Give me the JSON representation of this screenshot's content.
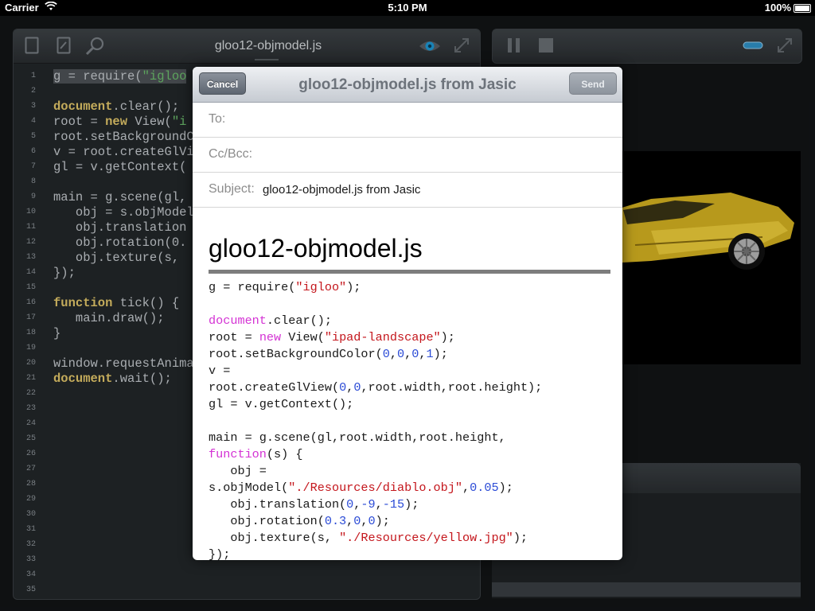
{
  "status_bar": {
    "carrier": "Carrier",
    "time": "5:10 PM",
    "battery": "100%"
  },
  "editor": {
    "title": "gloo12-objmodel.js",
    "lines": [
      {
        "n": "1",
        "html": "<span class=\"hl\">g = require(<span class=\"str\">\"igloo</span></span>"
      },
      {
        "n": "2",
        "html": ""
      },
      {
        "n": "3",
        "html": "<span class=\"kw\">document</span>.clear();"
      },
      {
        "n": "4",
        "html": "root = <span class=\"kw\">new</span> View(<span class=\"str\">\"i</span>"
      },
      {
        "n": "5",
        "html": "root.setBackgroundC"
      },
      {
        "n": "6",
        "html": "v = root.createGlVi"
      },
      {
        "n": "7",
        "html": "gl = v.getContext("
      },
      {
        "n": "8",
        "html": ""
      },
      {
        "n": "9",
        "html": "main = g.scene(gl,"
      },
      {
        "n": "10",
        "html": "   obj = s.objModel"
      },
      {
        "n": "11",
        "html": "   obj.translation"
      },
      {
        "n": "12",
        "html": "   obj.rotation(0."
      },
      {
        "n": "13",
        "html": "   obj.texture(s,"
      },
      {
        "n": "14",
        "html": "});"
      },
      {
        "n": "15",
        "html": ""
      },
      {
        "n": "16",
        "html": "<span class=\"kw\">function</span> tick() {"
      },
      {
        "n": "17",
        "html": "   main.draw();"
      },
      {
        "n": "18",
        "html": "}"
      },
      {
        "n": "19",
        "html": ""
      },
      {
        "n": "20",
        "html": "window.requestAnima"
      },
      {
        "n": "21",
        "html": "<span class=\"kw\">document</span>.wait();"
      },
      {
        "n": "22",
        "html": ""
      },
      {
        "n": "23",
        "html": ""
      },
      {
        "n": "24",
        "html": ""
      },
      {
        "n": "25",
        "html": ""
      },
      {
        "n": "26",
        "html": ""
      },
      {
        "n": "27",
        "html": ""
      },
      {
        "n": "28",
        "html": ""
      },
      {
        "n": "29",
        "html": ""
      },
      {
        "n": "30",
        "html": ""
      },
      {
        "n": "31",
        "html": ""
      },
      {
        "n": "32",
        "html": ""
      },
      {
        "n": "33",
        "html": ""
      },
      {
        "n": "34",
        "html": ""
      },
      {
        "n": "35",
        "html": ""
      }
    ]
  },
  "mail": {
    "cancel_label": "Cancel",
    "send_label": "Send",
    "title": "gloo12-objmodel.js from Jasic",
    "to_label": "To:",
    "ccbcc_label": "Cc/Bcc:",
    "subject_label": "Subject:",
    "subject_value": "gloo12-objmodel.js from Jasic",
    "body_title": "gloo12-objmodel.js",
    "body_lines": [
      "g = require(<span class=\"ms\">\"igloo\"</span>);",
      "",
      "<span class=\"mk\">document</span>.clear();",
      "root = <span class=\"mk\">new</span> View(<span class=\"ms\">\"ipad-landscape\"</span>);",
      "root.setBackgroundColor(<span class=\"mn\">0</span>,<span class=\"mn\">0</span>,<span class=\"mn\">0</span>,<span class=\"mn\">1</span>);",
      "v =",
      "root.createGlView(<span class=\"mn\">0</span>,<span class=\"mn\">0</span>,root.width,root.height);",
      "gl = v.getContext();",
      "",
      "main = g.scene(gl,root.width,root.height,",
      "<span class=\"mk\">function</span>(s) {",
      "   obj =",
      "s.objModel(<span class=\"ms\">\"./Resources/diablo.obj\"</span>,<span class=\"mn\">0.05</span>);",
      "   obj.translation(<span class=\"mn\">0</span>,<span class=\"mn\">-9</span>,<span class=\"mn\">-15</span>);",
      "   obj.rotation(<span class=\"mn\">0.3</span>,<span class=\"mn\">0</span>,<span class=\"mn\">0</span>);",
      "   obj.texture(s, <span class=\"ms\">\"./Resources/yellow.jpg\"</span>);",
      "});"
    ]
  },
  "colors": {
    "keyword": "#e6c96b",
    "string": "#6ec16e",
    "mail_keyword": "#d432d4",
    "mail_string": "#c4161c",
    "mail_number": "#2b4bd6"
  },
  "icons": [
    "new-file-icon",
    "edit-icon",
    "search-icon",
    "preview-eye-icon",
    "expand-icon",
    "pause-icon",
    "stop-icon",
    "toggle-pill-icon"
  ]
}
